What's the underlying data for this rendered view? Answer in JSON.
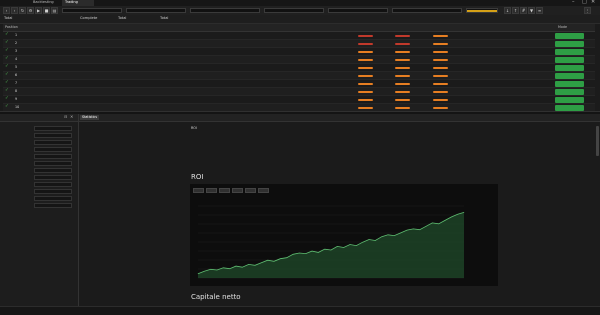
{
  "window": {
    "tabs": [
      "",
      "Backtesting",
      "Trading"
    ],
    "active_tab": 2,
    "controls": [
      "–",
      "□",
      "✕"
    ]
  },
  "toolbar": {
    "icons": [
      "back-icon",
      "forward-icon",
      "refresh-icon",
      "settings-icon",
      "play-icon",
      "stop-icon",
      "chart-icon",
      "list-icon",
      "filter-icon",
      "download-icon",
      "upload-icon",
      "grid-icon",
      "menu-icon"
    ],
    "accent_color": "#d4a017"
  },
  "summary": {
    "items": [
      "Total",
      "Complete",
      "Total",
      "Total"
    ]
  },
  "table": {
    "headers": [
      "Position",
      "",
      "",
      "",
      "",
      "",
      "",
      "",
      "",
      "",
      "",
      "",
      "",
      "",
      "",
      "",
      "",
      "Mode"
    ],
    "rows": [
      {
        "id": "1",
        "c1": "",
        "c2": "",
        "c3": "",
        "c4": "",
        "c5": "",
        "c6": "",
        "c7": "",
        "c8": "",
        "c9": "",
        "c10": "",
        "bar_color": "#c0392b",
        "btn": ""
      },
      {
        "id": "2",
        "c1": "",
        "c2": "",
        "c3": "",
        "c4": "",
        "c5": "",
        "c6": "",
        "c7": "",
        "c8": "",
        "c9": "",
        "c10": "",
        "bar_color": "#c0392b",
        "btn": ""
      },
      {
        "id": "3",
        "c1": "",
        "c2": "",
        "c3": "",
        "c4": "",
        "c5": "",
        "c6": "",
        "c7": "",
        "c8": "",
        "c9": "",
        "c10": "",
        "bar_color": "#e67e22",
        "btn": ""
      },
      {
        "id": "4",
        "c1": "",
        "c2": "",
        "c3": "",
        "c4": "",
        "c5": "",
        "c6": "",
        "c7": "",
        "c8": "",
        "c9": "",
        "c10": "",
        "bar_color": "#e67e22",
        "btn": ""
      },
      {
        "id": "5",
        "c1": "",
        "c2": "",
        "c3": "",
        "c4": "",
        "c5": "",
        "c6": "",
        "c7": "",
        "c8": "",
        "c9": "",
        "c10": "",
        "bar_color": "#e67e22",
        "btn": ""
      },
      {
        "id": "6",
        "c1": "",
        "c2": "",
        "c3": "",
        "c4": "",
        "c5": "",
        "c6": "",
        "c7": "",
        "c8": "",
        "c9": "",
        "c10": "",
        "bar_color": "#e67e22",
        "btn": ""
      },
      {
        "id": "7",
        "c1": "",
        "c2": "",
        "c3": "",
        "c4": "",
        "c5": "",
        "c6": "",
        "c7": "",
        "c8": "",
        "c9": "",
        "c10": "",
        "bar_color": "#e67e22",
        "btn": ""
      },
      {
        "id": "8",
        "c1": "",
        "c2": "",
        "c3": "",
        "c4": "",
        "c5": "",
        "c6": "",
        "c7": "",
        "c8": "",
        "c9": "",
        "c10": "",
        "bar_color": "#e67e22",
        "btn": ""
      },
      {
        "id": "9",
        "c1": "",
        "c2": "",
        "c3": "",
        "c4": "",
        "c5": "",
        "c6": "",
        "c7": "",
        "c8": "",
        "c9": "",
        "c10": "",
        "bar_color": "#e67e22",
        "btn": ""
      },
      {
        "id": "10",
        "c1": "",
        "c2": "",
        "c3": "",
        "c4": "",
        "c5": "",
        "c6": "",
        "c7": "",
        "c8": "",
        "c9": "",
        "c10": "",
        "bar_color": "#e67e22",
        "btn": ""
      }
    ]
  },
  "left_panel": {
    "title": "",
    "params": [
      {
        "label": "",
        "value": ""
      },
      {
        "label": "",
        "value": ""
      },
      {
        "label": "",
        "value": ""
      },
      {
        "label": "",
        "value": ""
      },
      {
        "label": "",
        "value": ""
      },
      {
        "label": "",
        "value": ""
      },
      {
        "label": "",
        "value": ""
      },
      {
        "label": "",
        "value": ""
      },
      {
        "label": "",
        "value": ""
      },
      {
        "label": "",
        "value": ""
      },
      {
        "label": "",
        "value": ""
      },
      {
        "label": "",
        "value": ""
      }
    ]
  },
  "right_panel": {
    "subtabs": [
      "Statistics",
      "",
      "",
      ""
    ],
    "stats_col1_labels": [
      "ROI",
      "",
      "",
      "",
      ""
    ],
    "stats_col1_values": [
      "",
      "",
      "",
      "",
      ""
    ],
    "stats_col2_labels": [
      "",
      "",
      "",
      ""
    ],
    "stats_col2_values": [
      "",
      "",
      "",
      ""
    ],
    "stats_col3_labels": [
      "",
      "",
      ""
    ],
    "stats_col3_values": [
      "",
      "",
      ""
    ],
    "roi_title": "ROI",
    "range_buttons": [
      "",
      "",
      "",
      "",
      "",
      ""
    ],
    "capital_title": "Capitale netto",
    "chart_legend": "",
    "chart_colors": {
      "line": "#5fbf72",
      "fill": "#1f4a2a"
    }
  },
  "chart_data": {
    "type": "area",
    "title": "ROI",
    "xlabel": "",
    "ylabel": "",
    "values": [
      0,
      1.2,
      2.1,
      1.8,
      2.8,
      2.4,
      3.6,
      3.1,
      4.4,
      4.0,
      5.2,
      6.4,
      5.9,
      7.1,
      7.6,
      9.2,
      9.8,
      9.5,
      10.7,
      10.1,
      11.6,
      11.2,
      12.9,
      12.4,
      13.8,
      13.3,
      14.9,
      16.2,
      15.7,
      17.5,
      18.4,
      18.0,
      19.3,
      20.6,
      21.2,
      20.8,
      22.4,
      24.0,
      23.6,
      25.2,
      26.8,
      28.1,
      29.0
    ],
    "ylim": [
      -2,
      32
    ],
    "grid": true,
    "legend": "top-right"
  },
  "status": {
    "left": "",
    "right": ""
  }
}
